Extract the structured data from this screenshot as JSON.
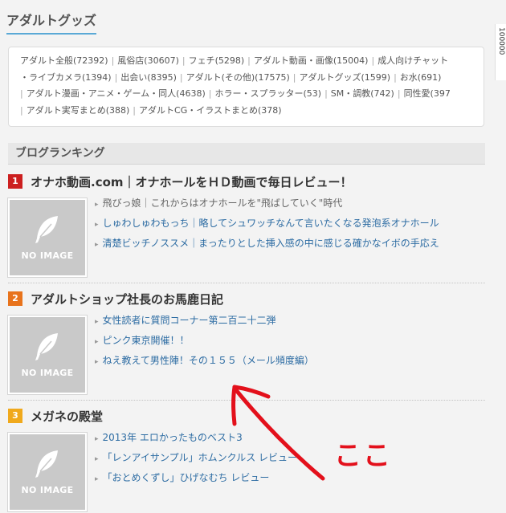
{
  "section": {
    "title": "アダルトグッズ"
  },
  "side_tab": {
    "text": "100000"
  },
  "tags": [
    {
      "label": "アダルト全般(72392)"
    },
    {
      "label": "風俗店(30607)"
    },
    {
      "label": "フェチ(5298)"
    },
    {
      "label": "アダルト動画・画像(15004)"
    },
    {
      "label": "成人向けチャット"
    },
    {
      "label": "・ライブカメラ(1394)"
    },
    {
      "label": "出会い(8395)"
    },
    {
      "label": "アダルト(その他)(17575)"
    },
    {
      "label": "アダルトグッズ(1599)"
    },
    {
      "label": "お水(691)"
    },
    {
      "label": "アダルト漫画・アニメ・ゲーム・同人(4638)"
    },
    {
      "label": "ホラー・スプラッター(53)"
    },
    {
      "label": "SM・調教(742)"
    },
    {
      "label": "同性愛(397"
    },
    {
      "label": "アダルト実写まとめ(388)"
    },
    {
      "label": "アダルトCG・イラストまとめ(378)"
    }
  ],
  "ranking": {
    "heading": "ブログランキング",
    "no_image_label": "NO IMAGE",
    "entries": [
      {
        "rank": "1",
        "badge_color": "#cc1f1f",
        "name": "オナホ動画.com｜オナホールをＨＤ動画で毎日レビュー！",
        "articles": [
          "飛びっ娘｜これからはオナホールを\"飛ばしていく\"時代",
          "しゅわしゅわもっち｜略してシュワッチなんて言いたくなる発泡系オナホール",
          "清楚ビッチノススメ｜まったりとした挿入感の中に感じる確かなイボの手応え"
        ]
      },
      {
        "rank": "2",
        "badge_color": "#e8731c",
        "name": "アダルトショップ社長のお馬鹿日記",
        "articles": [
          "女性読者に質問コーナー第二百二十二弾",
          "ピンク東京開催！！",
          "ねえ教えて男性陣！その１５５（メール頻度編）"
        ]
      },
      {
        "rank": "3",
        "badge_color": "#f0a91c",
        "name": "メガネの殿堂",
        "articles": [
          "2013年 エロかったものベスト3",
          "「レンアイサンプル」ホムンクルス レビュー",
          "「おとめくずし」ひげなむち レビュー"
        ]
      }
    ]
  },
  "annotation": {
    "text": "ここ",
    "color": "#e3101b"
  }
}
